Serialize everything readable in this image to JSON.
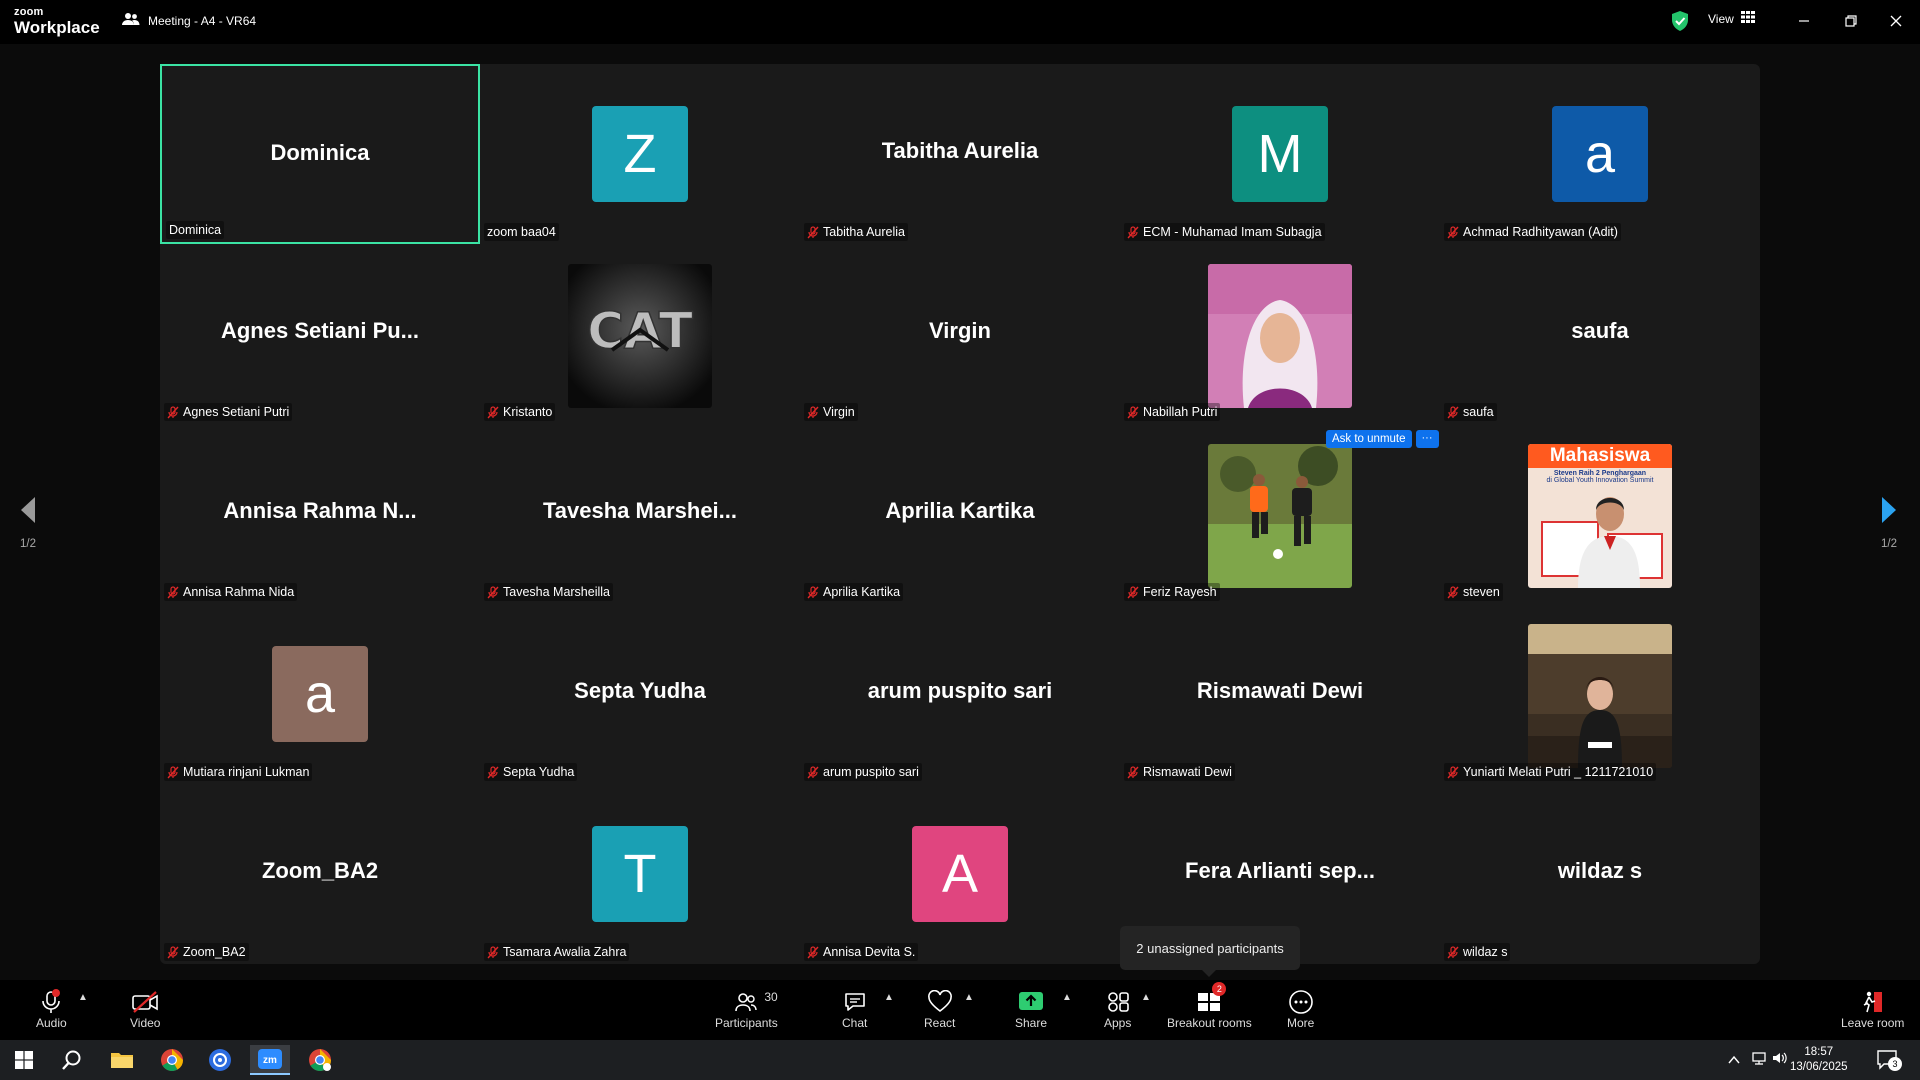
{
  "app": {
    "logo_line1": "zoom",
    "logo_line2": "Workplace",
    "meeting_title": "Meeting - A4 - VR64",
    "view_label": "View"
  },
  "colors": {
    "active_border": "#3be3a4",
    "accent_blue": "#0e72ed",
    "mute_red": "#e02828",
    "share_green": "#2ecc71"
  },
  "tiles": [
    {
      "big": "Dominica",
      "label": "Dominica",
      "muted": false,
      "active": true
    },
    {
      "avatar": "Z",
      "color": "#1aa0b4",
      "label": "zoom baa04",
      "muted": false
    },
    {
      "big": "Tabitha Aurelia",
      "label": "Tabitha Aurelia",
      "muted": true
    },
    {
      "avatar": "M",
      "color": "#0d8f80",
      "label": "ECM - Muhamad Imam Subagja",
      "muted": true
    },
    {
      "avatar": "a",
      "color": "#0e5aa8",
      "label": "Achmad Radhityawan (Adit)",
      "muted": true
    },
    {
      "big": "Agnes Setiani Pu...",
      "label": "Agnes Setiani Putri",
      "muted": true
    },
    {
      "video": "cat",
      "label": "Kristanto",
      "muted": true
    },
    {
      "big": "Virgin",
      "label": "Virgin",
      "muted": true
    },
    {
      "video": "hijab",
      "label": "Nabillah Putri",
      "muted": true
    },
    {
      "big": "saufa",
      "label": "saufa",
      "muted": true
    },
    {
      "big": "Annisa Rahma N...",
      "label": "Annisa Rahma Nida",
      "muted": true
    },
    {
      "big": "Tavesha Marshei...",
      "label": "Tavesha Marsheilla",
      "muted": true
    },
    {
      "big": "Aprilia Kartika",
      "label": "Aprilia Kartika",
      "muted": true
    },
    {
      "video": "football",
      "label": "Feriz Rayesh",
      "muted": true
    },
    {
      "video": "poster",
      "label": "steven",
      "muted": true,
      "poster_title": "Mahasiswa",
      "poster_line1": "Steven Raih 2 Penghargaan",
      "poster_line2": "di Global Youth Innovation Summit"
    },
    {
      "avatar": "a",
      "color": "#8a6a5e",
      "label": "Mutiara rinjani Lukman",
      "muted": true
    },
    {
      "big": "Septa Yudha",
      "label": "Septa Yudha",
      "muted": true
    },
    {
      "big": "arum puspito sari",
      "label": "arum puspito sari",
      "muted": true
    },
    {
      "big": "Rismawati Dewi",
      "label": "Rismawati Dewi",
      "muted": true
    },
    {
      "video": "office",
      "label": "Yuniarti Melati Putri _ 1211721010",
      "muted": true
    },
    {
      "big": "Zoom_BA2",
      "label": "Zoom_BA2",
      "muted": true
    },
    {
      "avatar": "T",
      "color": "#1aa0b4",
      "label": "Tsamara Awalia Zahra",
      "muted": true
    },
    {
      "avatar": "A",
      "color": "#e0457f",
      "label": "Annisa Devita S.",
      "muted": true
    },
    {
      "big": "Fera Arlianti sep...",
      "label": "",
      "muted": false
    },
    {
      "big": "wildaz s",
      "label": "wildaz s",
      "muted": true
    }
  ],
  "ask_unmute": {
    "label": "Ask to unmute",
    "more": "···"
  },
  "tooltip": "2 unassigned participants",
  "pager": {
    "left": "1/2",
    "right": "1/2"
  },
  "toolbar": {
    "audio": "Audio",
    "video": "Video",
    "participants": "Participants",
    "participants_count": "30",
    "chat": "Chat",
    "react": "React",
    "share": "Share",
    "apps": "Apps",
    "breakout": "Breakout rooms",
    "breakout_badge": "2",
    "more": "More",
    "leave": "Leave room"
  },
  "taskbar": {
    "time": "18:57",
    "date": "13/06/2025",
    "notif": "3"
  }
}
